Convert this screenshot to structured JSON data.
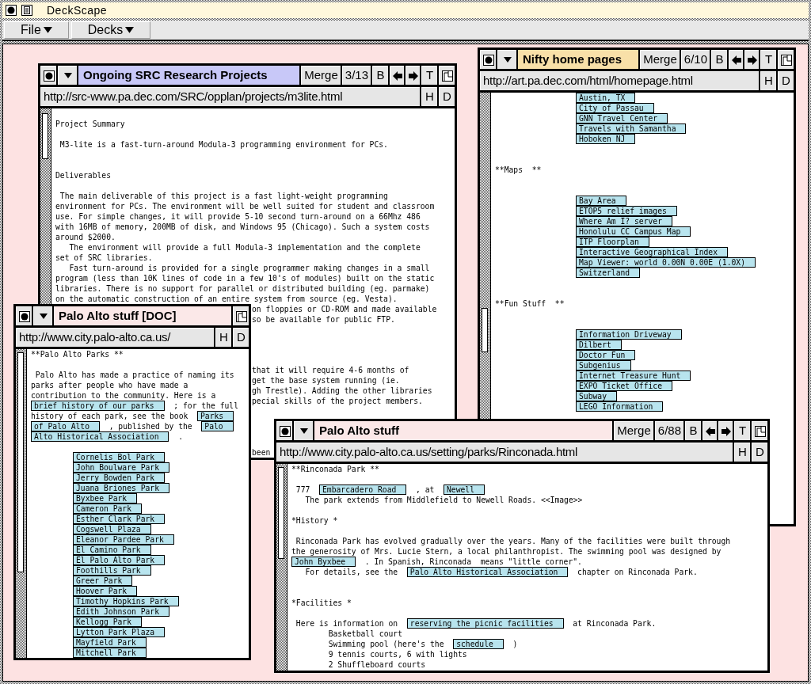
{
  "app": {
    "title": "DeckScape"
  },
  "menus": [
    {
      "label": "File"
    },
    {
      "label": "Decks"
    }
  ],
  "windows": [
    {
      "title": "Ongoing SRC Research Projects",
      "color": "#c8c8f8",
      "toolbar": [
        {
          "kind": "text",
          "label": "Merge"
        },
        {
          "kind": "text",
          "label": "3/13"
        },
        {
          "kind": "text",
          "label": "B"
        },
        {
          "kind": "back"
        },
        {
          "kind": "forward"
        },
        {
          "kind": "text",
          "label": "T"
        },
        {
          "kind": "corner"
        }
      ],
      "url": "http://src-www.pa.dec.com/SRC/opplan/projects/m3lite.html",
      "url_buttons": [
        "H",
        "D"
      ],
      "body": [
        {
          "kind": "blank"
        },
        {
          "kind": "heading",
          "text": "Project Summary"
        },
        {
          "kind": "blank"
        },
        {
          "kind": "heading",
          "text": " M3-lite is a fast-turn-around Modula-3 programming environment for PCs."
        },
        {
          "kind": "blank"
        },
        {
          "kind": "blank"
        },
        {
          "kind": "heading",
          "text": "Deliverables"
        },
        {
          "kind": "blank"
        },
        {
          "kind": "para",
          "segments": [
            {
              "kind": "text",
              "text": " The main deliverable of this project is a fast light-weight programming\nenvironment for PCs. The environment will be well suited for student and classroom\nuse. For simple changes, it will provide 5-10 second turn-around on a 66Mhz 486\nwith 16MB of memory, 200MB of disk, and Windows 95 (Chicago). Such a system costs\naround $2000.\n   The environment will provide a full Modula-3 implementation and the complete\nset of SRC libraries.\n   Fast turn-around is provided for a single programmer making changes in a small\nprogram (less than 10K lines of code in a few 10's of modules) built on the static\nlibraries. There is no support for parallel or distributed building (eg. parmake)\non the automatic construction of an entire system from source (eg. Vesta)."
            }
          ]
        },
        {
          "kind": "clipped",
          "text": "on floppies or CD-ROM and made available"
        },
        {
          "kind": "clipped",
          "text": "so be available for public FTP."
        },
        {
          "kind": "blank"
        },
        {
          "kind": "blank"
        },
        {
          "kind": "blank"
        },
        {
          "kind": "blank"
        },
        {
          "kind": "clipped",
          "text": "that it will require 4-6 months of"
        },
        {
          "kind": "clipped",
          "text": "get the base system running (ie."
        },
        {
          "kind": "clipped",
          "text": "gh Trestle). Adding the other libraries"
        },
        {
          "kind": "clipped",
          "text": "pecial skills of the project members."
        },
        {
          "kind": "blank"
        },
        {
          "kind": "blank"
        },
        {
          "kind": "blank"
        },
        {
          "kind": "blank"
        },
        {
          "kind": "clipped",
          "text": "been"
        }
      ]
    },
    {
      "title": "Nifty home pages",
      "color": "#f8e0a8",
      "toolbar": [
        {
          "kind": "text",
          "label": "Merge"
        },
        {
          "kind": "text",
          "label": "6/10"
        },
        {
          "kind": "text",
          "label": "B"
        },
        {
          "kind": "back"
        },
        {
          "kind": "forward"
        },
        {
          "kind": "text",
          "label": "T"
        },
        {
          "kind": "corner"
        }
      ],
      "url": "http://art.pa.dec.com/html/homepage.html",
      "url_buttons": [
        "H",
        "D"
      ],
      "body": [
        {
          "kind": "link",
          "text": "Austin, TX"
        },
        {
          "kind": "link",
          "text": "City of Passau"
        },
        {
          "kind": "link",
          "text": "GNN Travel Center"
        },
        {
          "kind": "link",
          "text": "Travels with Samantha"
        },
        {
          "kind": "link",
          "text": "Hoboken NJ"
        },
        {
          "kind": "blank"
        },
        {
          "kind": "blank"
        },
        {
          "kind": "heading",
          "text": "**Maps  **"
        },
        {
          "kind": "blank"
        },
        {
          "kind": "blank"
        },
        {
          "kind": "link",
          "text": "Bay Area"
        },
        {
          "kind": "link",
          "text": "ETOP5 relief images"
        },
        {
          "kind": "link",
          "text": "Where Am I? server"
        },
        {
          "kind": "link",
          "text": "Honolulu CC Campus Map"
        },
        {
          "kind": "link",
          "text": "ITP Floorplan"
        },
        {
          "kind": "link",
          "text": "Interactive Geographical Index"
        },
        {
          "kind": "link",
          "text": "Map Viewer: world 0.00N 0.00E (1.0X)"
        },
        {
          "kind": "link",
          "text": "Switzerland"
        },
        {
          "kind": "blank"
        },
        {
          "kind": "blank"
        },
        {
          "kind": "heading",
          "text": "**Fun Stuff  **"
        },
        {
          "kind": "blank"
        },
        {
          "kind": "blank"
        },
        {
          "kind": "link",
          "text": "Information Driveway"
        },
        {
          "kind": "link",
          "text": "Dilbert"
        },
        {
          "kind": "link",
          "text": "Doctor Fun"
        },
        {
          "kind": "link",
          "text": "Subgenius"
        },
        {
          "kind": "link",
          "text": "Internet Treasure Hunt"
        },
        {
          "kind": "link",
          "text": "EXPO Ticket Office"
        },
        {
          "kind": "link",
          "text": "Subway"
        },
        {
          "kind": "link",
          "text": "LEGO Information"
        }
      ]
    },
    {
      "title": "Palo Alto stuff [DOC]",
      "color": "#fbe8e8",
      "toolbar": [
        {
          "kind": "corner"
        }
      ],
      "url": "http://www.city.palo-alto.ca.us/",
      "url_buttons": [
        "H",
        "D"
      ],
      "body": [
        {
          "kind": "heading",
          "text": "**Palo Alto Parks **"
        },
        {
          "kind": "blank"
        },
        {
          "kind": "para",
          "segments": [
            {
              "kind": "text",
              "text": " Palo Alto has made a practice of naming its\nparks after people who have made a\ncontribution to the community. Here is a\n"
            },
            {
              "kind": "link",
              "text": "brief history of our parks"
            },
            {
              "kind": "text",
              "text": "  ; for the full\nhistory of each park, see the book  "
            },
            {
              "kind": "link",
              "text": "Parks"
            },
            {
              "kind": "break"
            },
            {
              "kind": "link",
              "text": "of Palo Alto"
            },
            {
              "kind": "text",
              "text": "  , published by the  "
            },
            {
              "kind": "link",
              "text": "Palo"
            },
            {
              "kind": "break"
            },
            {
              "kind": "link",
              "text": "Alto Historical Association"
            },
            {
              "kind": "text",
              "text": "  ."
            }
          ]
        },
        {
          "kind": "blank"
        },
        {
          "kind": "link",
          "text": "Cornelis Bol Park"
        },
        {
          "kind": "link",
          "text": "John Boulware Park"
        },
        {
          "kind": "link",
          "text": "Jerry Bowden Park"
        },
        {
          "kind": "link",
          "text": "Juana Briones Park"
        },
        {
          "kind": "link",
          "text": "Byxbee Park"
        },
        {
          "kind": "link",
          "text": "Cameron Park"
        },
        {
          "kind": "link",
          "text": "Esther Clark Park"
        },
        {
          "kind": "link",
          "text": "Cogswell Plaza"
        },
        {
          "kind": "link",
          "text": "Eleanor Pardee Park"
        },
        {
          "kind": "link",
          "text": "El Camino Park"
        },
        {
          "kind": "link",
          "text": "El Palo Alto Park"
        },
        {
          "kind": "link",
          "text": "Foothills Park"
        },
        {
          "kind": "link",
          "text": "Greer Park"
        },
        {
          "kind": "link",
          "text": "Hoover Park"
        },
        {
          "kind": "link",
          "text": "Timothy Hopkins Park"
        },
        {
          "kind": "link",
          "text": "Edith Johnson Park"
        },
        {
          "kind": "link",
          "text": "Kellogg Park"
        },
        {
          "kind": "link",
          "text": "Lytton Park Plaza"
        },
        {
          "kind": "link",
          "text": "Mayfield Park"
        },
        {
          "kind": "link",
          "text": "Mitchell Park"
        }
      ]
    },
    {
      "title": "Palo Alto stuff",
      "color": "#fbe8e8",
      "toolbar": [
        {
          "kind": "text",
          "label": "Merge"
        },
        {
          "kind": "text",
          "label": "6/88"
        },
        {
          "kind": "text",
          "label": "B"
        },
        {
          "kind": "back"
        },
        {
          "kind": "forward"
        },
        {
          "kind": "text",
          "label": "T"
        },
        {
          "kind": "corner"
        }
      ],
      "url": "http://www.city.palo-alto.ca.us/setting/parks/Rinconada.html",
      "url_buttons": [
        "H",
        "D"
      ],
      "body": [
        {
          "kind": "heading",
          "text": "**Rinconada Park **"
        },
        {
          "kind": "blank"
        },
        {
          "kind": "para",
          "segments": [
            {
              "kind": "text",
              "text": " 777  "
            },
            {
              "kind": "link",
              "text": "Embarcadero Road"
            },
            {
              "kind": "text",
              "text": "  , at  "
            },
            {
              "kind": "link",
              "text": "Newell"
            },
            {
              "kind": "text",
              "text": "\n   The park extends from Middlefield to Newell Roads. <<Image>>"
            }
          ]
        },
        {
          "kind": "blank"
        },
        {
          "kind": "heading",
          "text": "*History *"
        },
        {
          "kind": "blank"
        },
        {
          "kind": "para",
          "segments": [
            {
              "kind": "text",
              "text": " Rinconada Park has evolved gradually over the years. Many of the facilities were built through\nthe generosity of Mrs. Lucie Stern, a local philanthropist. The swimming pool was designed by\n"
            },
            {
              "kind": "link",
              "text": "John Byxbee"
            },
            {
              "kind": "text",
              "text": "  . In Spanish, Rinconada  means \"little corner\".\n   For details, see the  "
            },
            {
              "kind": "link",
              "text": "Palo Alto Historical Association"
            },
            {
              "kind": "text",
              "text": "  chapter on Rinconada Park."
            }
          ]
        },
        {
          "kind": "blank"
        },
        {
          "kind": "blank"
        },
        {
          "kind": "heading",
          "text": "*Facilities *"
        },
        {
          "kind": "blank"
        },
        {
          "kind": "para",
          "segments": [
            {
              "kind": "text",
              "text": " Here is information on  "
            },
            {
              "kind": "link",
              "text": "reserving the picnic facilities"
            },
            {
              "kind": "text",
              "text": "  at Rinconada Park.\n        Basketball court\n        Swimming pool (here's the  "
            },
            {
              "kind": "link",
              "text": "schedule"
            },
            {
              "kind": "text",
              "text": "  )\n        9 tennis courts, 6 with lights\n        2 Shuffleboard courts"
            }
          ]
        }
      ]
    }
  ]
}
